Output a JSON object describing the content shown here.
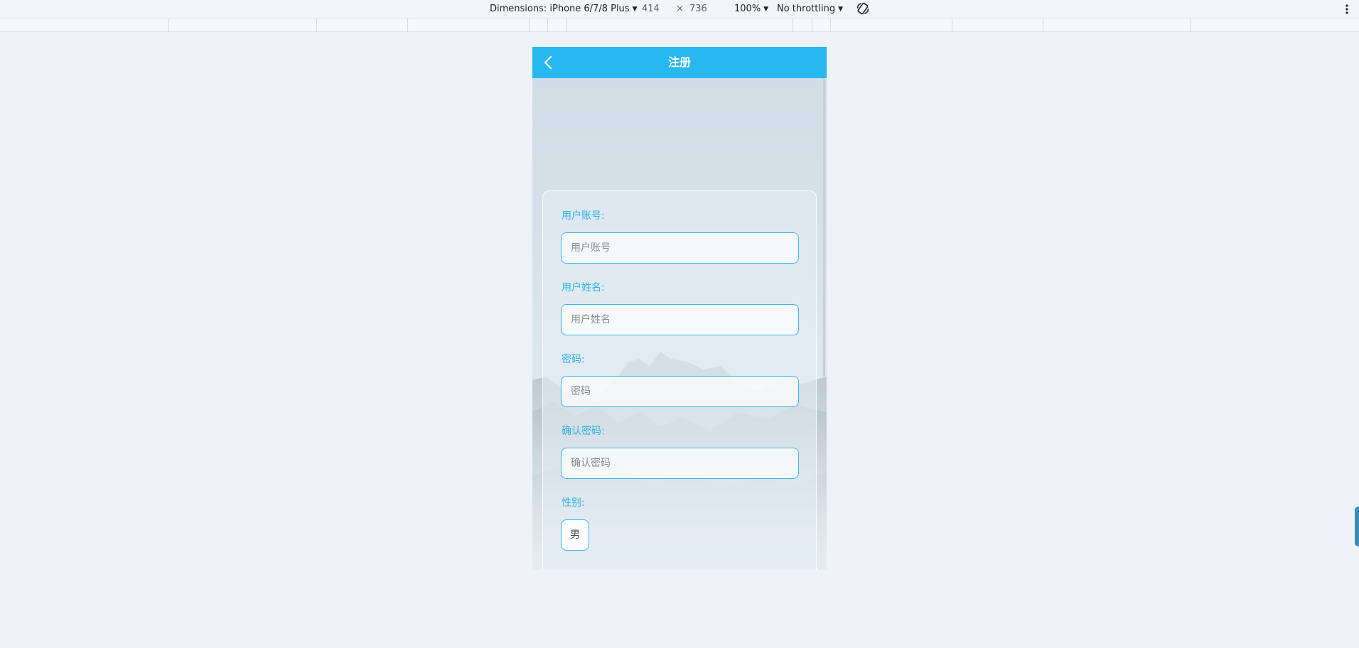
{
  "devtools": {
    "dimensions_label": "Dimensions: iPhone 6/7/8 Plus",
    "width_value": "414",
    "times_sign": "×",
    "height_value": "736",
    "zoom": "100%",
    "throttling": "No throttling"
  },
  "header": {
    "title": "注册"
  },
  "form": {
    "account": {
      "label": "用户账号:",
      "placeholder": "用户账号"
    },
    "name": {
      "label": "用户姓名:",
      "placeholder": "用户姓名"
    },
    "password": {
      "label": "密码:",
      "placeholder": "密码"
    },
    "confirm": {
      "label": "确认密码:",
      "placeholder": "确认密码"
    },
    "gender": {
      "label": "性别:",
      "selected": "男"
    }
  },
  "colors": {
    "header": "#27b8f0",
    "accent": "#2bb2e6",
    "page_bg": "#eef2f9"
  }
}
